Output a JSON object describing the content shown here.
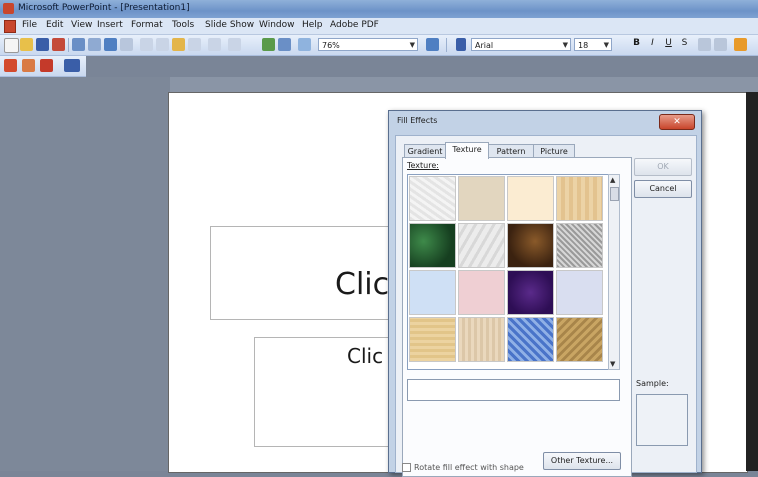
{
  "window": {
    "title": "Microsoft PowerPoint - [Presentation1]"
  },
  "menu": [
    "File",
    "Edit",
    "View",
    "Insert",
    "Format",
    "Tools",
    "Slide Show",
    "Window",
    "Help",
    "Adobe PDF"
  ],
  "toolbar": {
    "zoom": "76%",
    "font": "Arial",
    "font_size": "18"
  },
  "slide": {
    "title_placeholder": "Clic",
    "subtitle_placeholder": "Clic"
  },
  "dialog": {
    "title": "Fill Effects",
    "tabs": [
      "Gradient",
      "Texture",
      "Pattern",
      "Picture"
    ],
    "active_tab": "Texture",
    "texture_label": "Texture:",
    "textures": [
      "newsprint",
      "recycled paper",
      "parchment",
      "papyrus",
      "green marble",
      "white marble",
      "brown marble",
      "granite",
      "blue tissue paper",
      "pink tissue paper",
      "purple mesh",
      "bouquet",
      "canvas",
      "woven mat",
      "water droplets",
      "fish fossil"
    ],
    "ok_label": "OK",
    "cancel_label": "Cancel",
    "other_texture_label": "Other Texture...",
    "sample_label": "Sample:",
    "rotate_label": "Rotate fill effect with shape"
  },
  "colors": {
    "title_bar": "#7ea2d2",
    "close_button": "#c8452b"
  }
}
